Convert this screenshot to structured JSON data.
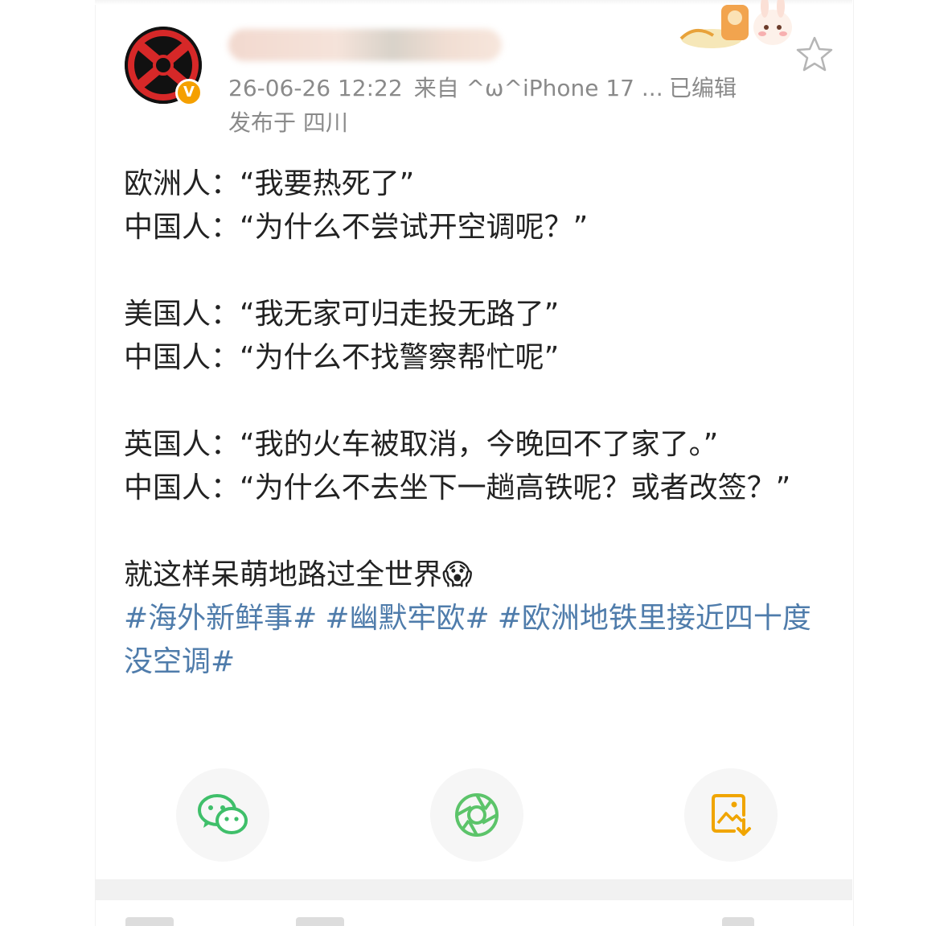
{
  "post": {
    "author_avatar_icon": "avatar-icon",
    "verified_badge": "V",
    "timestamp": "26-06-26 12:22",
    "source": "来自 ^ω^iPhone 17 ...",
    "edited": "已编辑",
    "location": "发布于 四川",
    "lines": [
      "欧洲人：“我要热死了”",
      "中国人：“为什么不尝试开空调呢？”",
      "",
      "美国人：“我无家可归走投无路了”",
      "中国人：“为什么不找警察帮忙呢”",
      "",
      "英国人：“我的火车被取消，今晚回不了家了。”",
      "中国人：“为什么不去坐下一趟高铁呢？或者改签？”",
      "",
      "就这样呆萌地路过全世界😱"
    ],
    "hashtags": [
      "#海外新鲜事#",
      "#幽默牢欧#",
      "#欧洲地铁里接近四十度没空调#"
    ]
  },
  "share": {
    "buttons": [
      {
        "icon": "wechat-icon"
      },
      {
        "icon": "moments-icon"
      },
      {
        "icon": "save-image-icon"
      }
    ]
  },
  "colors": {
    "hashtag": "#4f7cab",
    "wechat_green": "#3fbf6a",
    "save_orange": "#f0a500",
    "meta_gray": "#8a8a8a"
  }
}
